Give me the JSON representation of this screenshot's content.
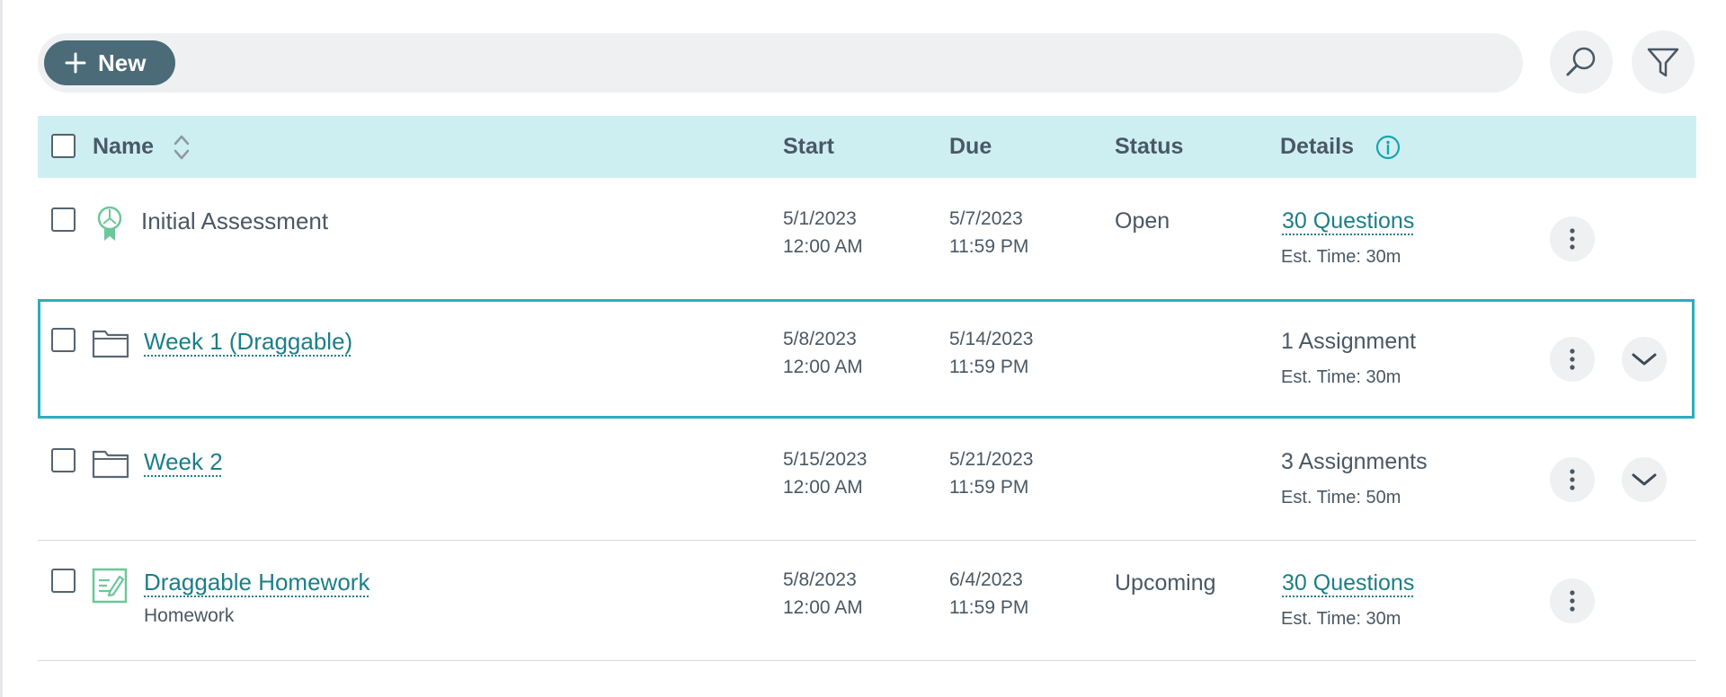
{
  "toolbar": {
    "new_label": "New",
    "new_icon": "plus-icon",
    "search_icon": "search-icon",
    "filter_icon": "filter-icon"
  },
  "table": {
    "columns": {
      "name": "Name",
      "start": "Start",
      "due": "Due",
      "status": "Status",
      "details": "Details"
    },
    "rows": [
      {
        "icon": "assessment-ribbon-icon",
        "name": "Initial Assessment",
        "subtitle": "",
        "start_date": "5/1/2023",
        "start_time": "12:00 AM",
        "due_date": "5/7/2023",
        "due_time": "11:59 PM",
        "status": "Open",
        "details": "30 Questions",
        "est_time": "Est. Time: 30m"
      },
      {
        "icon": "folder-icon",
        "name": "Week 1 (Draggable)",
        "subtitle": "",
        "start_date": "5/8/2023",
        "start_time": "12:00 AM",
        "due_date": "5/14/2023",
        "due_time": "11:59 PM",
        "status": "",
        "details": "1 Assignment",
        "est_time": "Est. Time: 30m"
      },
      {
        "icon": "folder-icon",
        "name": "Week 2",
        "subtitle": "",
        "start_date": "5/15/2023",
        "start_time": "12:00 AM",
        "due_date": "5/21/2023",
        "due_time": "11:59 PM",
        "status": "",
        "details": "3 Assignments",
        "est_time": "Est. Time: 50m"
      },
      {
        "icon": "homework-icon",
        "name": "Draggable Homework",
        "subtitle": "Homework",
        "start_date": "5/8/2023",
        "start_time": "12:00 AM",
        "due_date": "6/4/2023",
        "due_time": "11:59 PM",
        "status": "Upcoming",
        "details": "30 Questions",
        "est_time": "Est. Time: 30m"
      }
    ]
  },
  "colors": {
    "accent": "#2aaebb",
    "link": "#1c7e88",
    "header_bg": "#cdeff2",
    "new_button": "#4b6b78",
    "assessment_icon": "#6cc79a"
  }
}
